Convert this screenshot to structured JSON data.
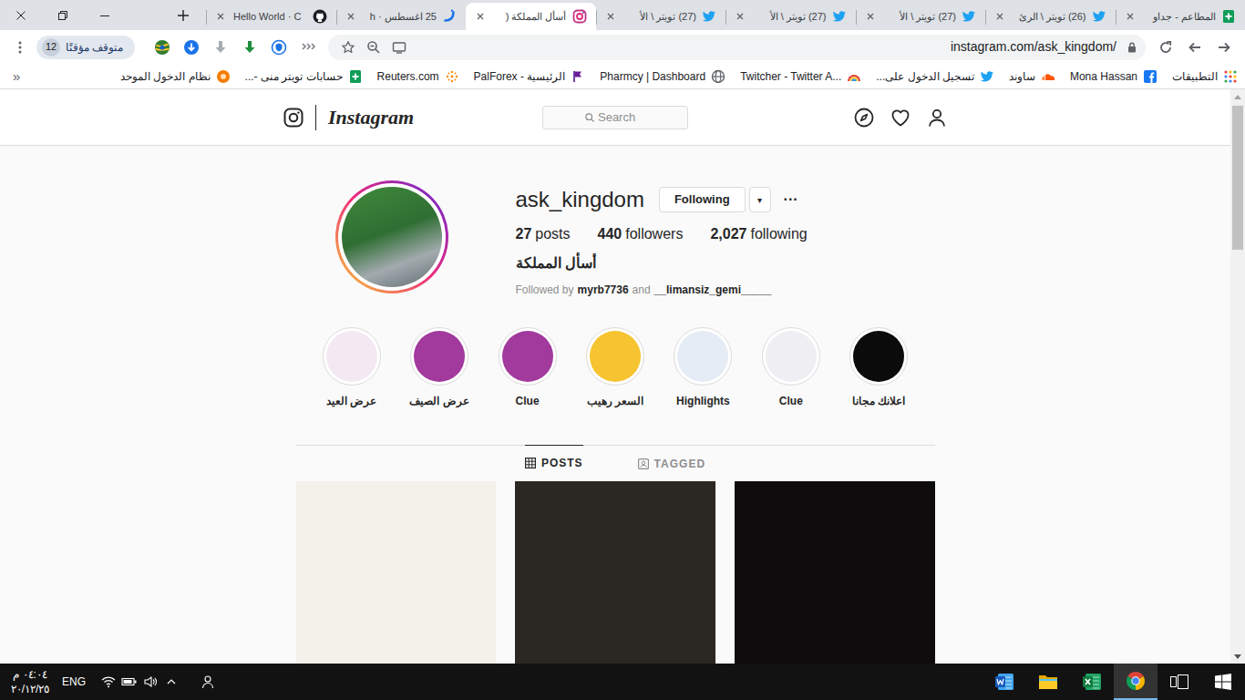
{
  "browser": {
    "tabs": [
      {
        "label": "المطاعم - جداو",
        "kind": "sheets",
        "selected": false
      },
      {
        "label": "(26) تويتر \\ الرئ",
        "kind": "twitter",
        "selected": false
      },
      {
        "label": "(27) تويتر \\ الأ",
        "kind": "twitter",
        "selected": false
      },
      {
        "label": "(27) تويتر \\ الأ",
        "kind": "twitter",
        "selected": false
      },
      {
        "label": "(27) تويتر \\ الأ",
        "kind": "twitter",
        "selected": false
      },
      {
        "label": "أسأل المملكة (",
        "kind": "instagram",
        "selected": true
      },
      {
        "label": "25 اغسطس · h",
        "kind": "news",
        "selected": false
      },
      {
        "label": "Hello World · C",
        "kind": "github",
        "selected": false
      }
    ],
    "profile_chip": {
      "label": "متوقف مؤقتًا",
      "badge": "12"
    },
    "address": {
      "url": "instagram.com/ask_kingdom/"
    },
    "bookmarks": [
      {
        "label": "التطبيقات",
        "kind": "apps"
      },
      {
        "label": "Mona Hassan",
        "kind": "facebook"
      },
      {
        "label": "ساوند",
        "kind": "soundcloud"
      },
      {
        "label": "تسجيل الدخول على...",
        "kind": "twitter"
      },
      {
        "label": "Twitcher - Twitter A...",
        "kind": "rainbow"
      },
      {
        "label": "Pharmcy | Dashboard",
        "kind": "globe"
      },
      {
        "label": "الرئيسية - PalForex",
        "kind": "flag"
      },
      {
        "label": "Reuters.com",
        "kind": "reuters"
      },
      {
        "label": "حسابات تويتر منى -...",
        "kind": "sheets"
      },
      {
        "label": "نظام الدخول الموحد",
        "kind": "orange"
      }
    ],
    "bookmarks_overflow": "»"
  },
  "page": {
    "logo": "Instagram",
    "search": {
      "placeholder": "Search"
    },
    "profile": {
      "username": "ask_kingdom",
      "follow_button": "Following",
      "dropdown": "▾",
      "more": "···",
      "stats": [
        {
          "count": "27",
          "label": "posts"
        },
        {
          "count": "440",
          "label": "followers"
        },
        {
          "count": "2,027",
          "label": "following"
        }
      ],
      "bio": "أسأل المملكة",
      "followed_by": {
        "prefix": "Followed by",
        "users": [
          "myrb7736",
          "__limansiz_gemi_____"
        ],
        "joiner": "and"
      }
    },
    "highlights": [
      {
        "label": "عرض العيد",
        "color": "#f3e9f3"
      },
      {
        "label": "عرض الصيف",
        "color": "#a2399d"
      },
      {
        "label": "Clue",
        "color": "#a2399d"
      },
      {
        "label": "السعر رهيب",
        "color": "#f6c431"
      },
      {
        "label": "Highlights",
        "color": "#e6ecf5"
      },
      {
        "label": "Clue",
        "color": "#eeeef3"
      },
      {
        "label": "اعلانك مجانا",
        "color": "#0b0b0b"
      }
    ],
    "tabs": [
      {
        "label": "POSTS",
        "selected": true
      },
      {
        "label": "TAGGED",
        "selected": false
      }
    ],
    "posts": [
      {
        "color": "#f4f1ea"
      },
      {
        "color": "#2b2723"
      },
      {
        "color": "#0d0b0b"
      }
    ]
  },
  "taskbar": {
    "time": "٠٤:٠٤ م",
    "date": "٢٠/١٢/٢٥",
    "language": "ENG",
    "apps": [
      {
        "kind": "start",
        "selected": false
      },
      {
        "kind": "task-view",
        "selected": false
      },
      {
        "kind": "chrome",
        "selected": true
      },
      {
        "kind": "excel",
        "selected": false
      },
      {
        "kind": "explorer",
        "selected": false
      },
      {
        "kind": "word",
        "selected": false
      }
    ]
  }
}
